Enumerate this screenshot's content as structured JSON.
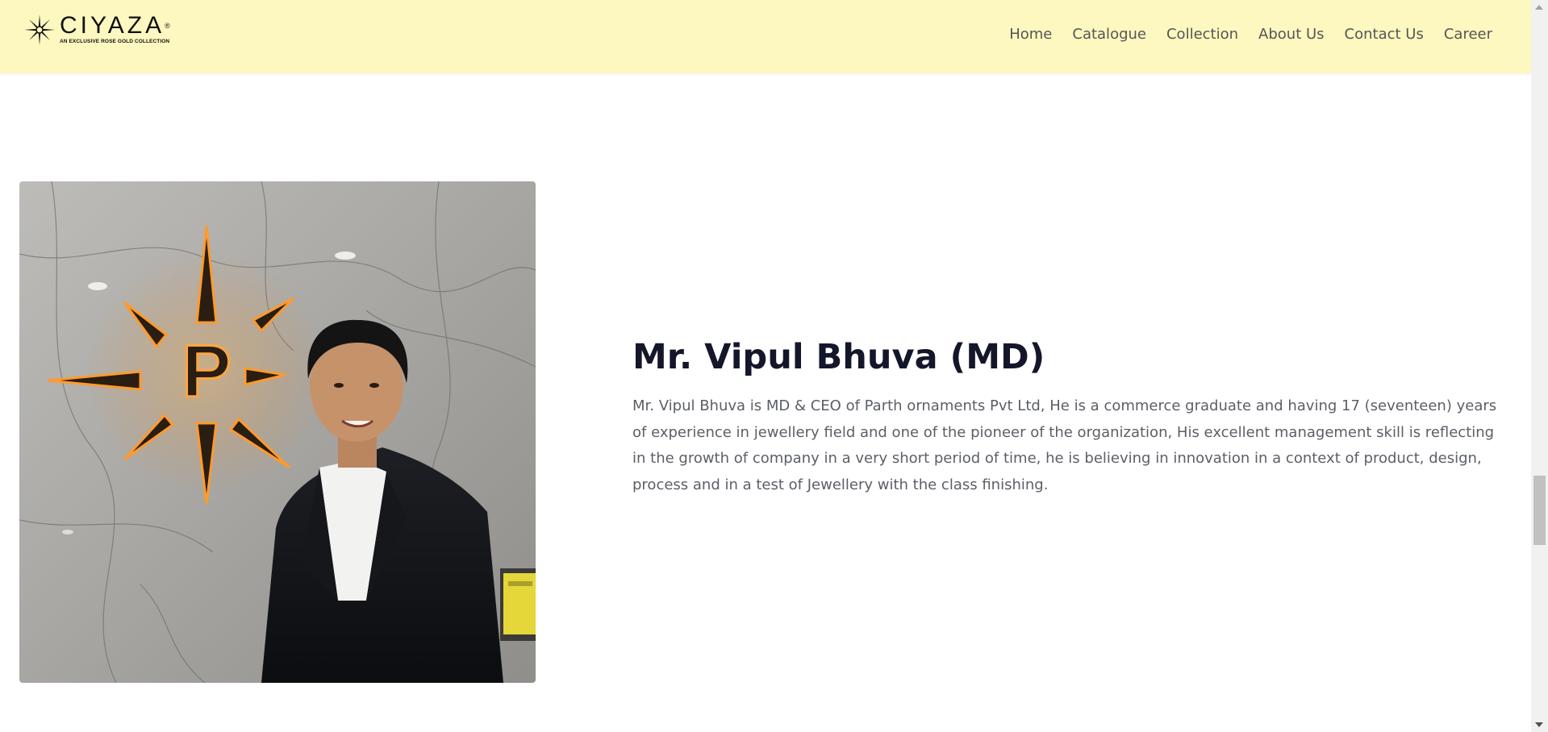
{
  "brand": {
    "name": "CIYAZA",
    "registered_mark": "®",
    "tagline": "AN EXCLUSIVE ROSE GOLD COLLECTION",
    "header_bg": "#fdf8c0"
  },
  "nav": {
    "items": [
      {
        "label": "Home"
      },
      {
        "label": "Catalogue"
      },
      {
        "label": "Collection"
      },
      {
        "label": "About Us"
      },
      {
        "label": "Contact Us"
      },
      {
        "label": "Career"
      }
    ]
  },
  "profile": {
    "name": "Mr. Vipul Bhuva (MD)",
    "bio": "Mr. Vipul Bhuva is MD & CEO of Parth ornaments Pvt Ltd, He is a commerce graduate and having 17 (seventeen) years of experience in jewellery field and one of the pioneer of the organization, His excellent management skill is reflecting in the growth of company in a very short period of time, he is believing in innovation in a context of product, design, process and in a test of Jewellery with the class finishing.",
    "photo_logo_letter": "P",
    "photo_description_icon": "portrait-photo"
  }
}
